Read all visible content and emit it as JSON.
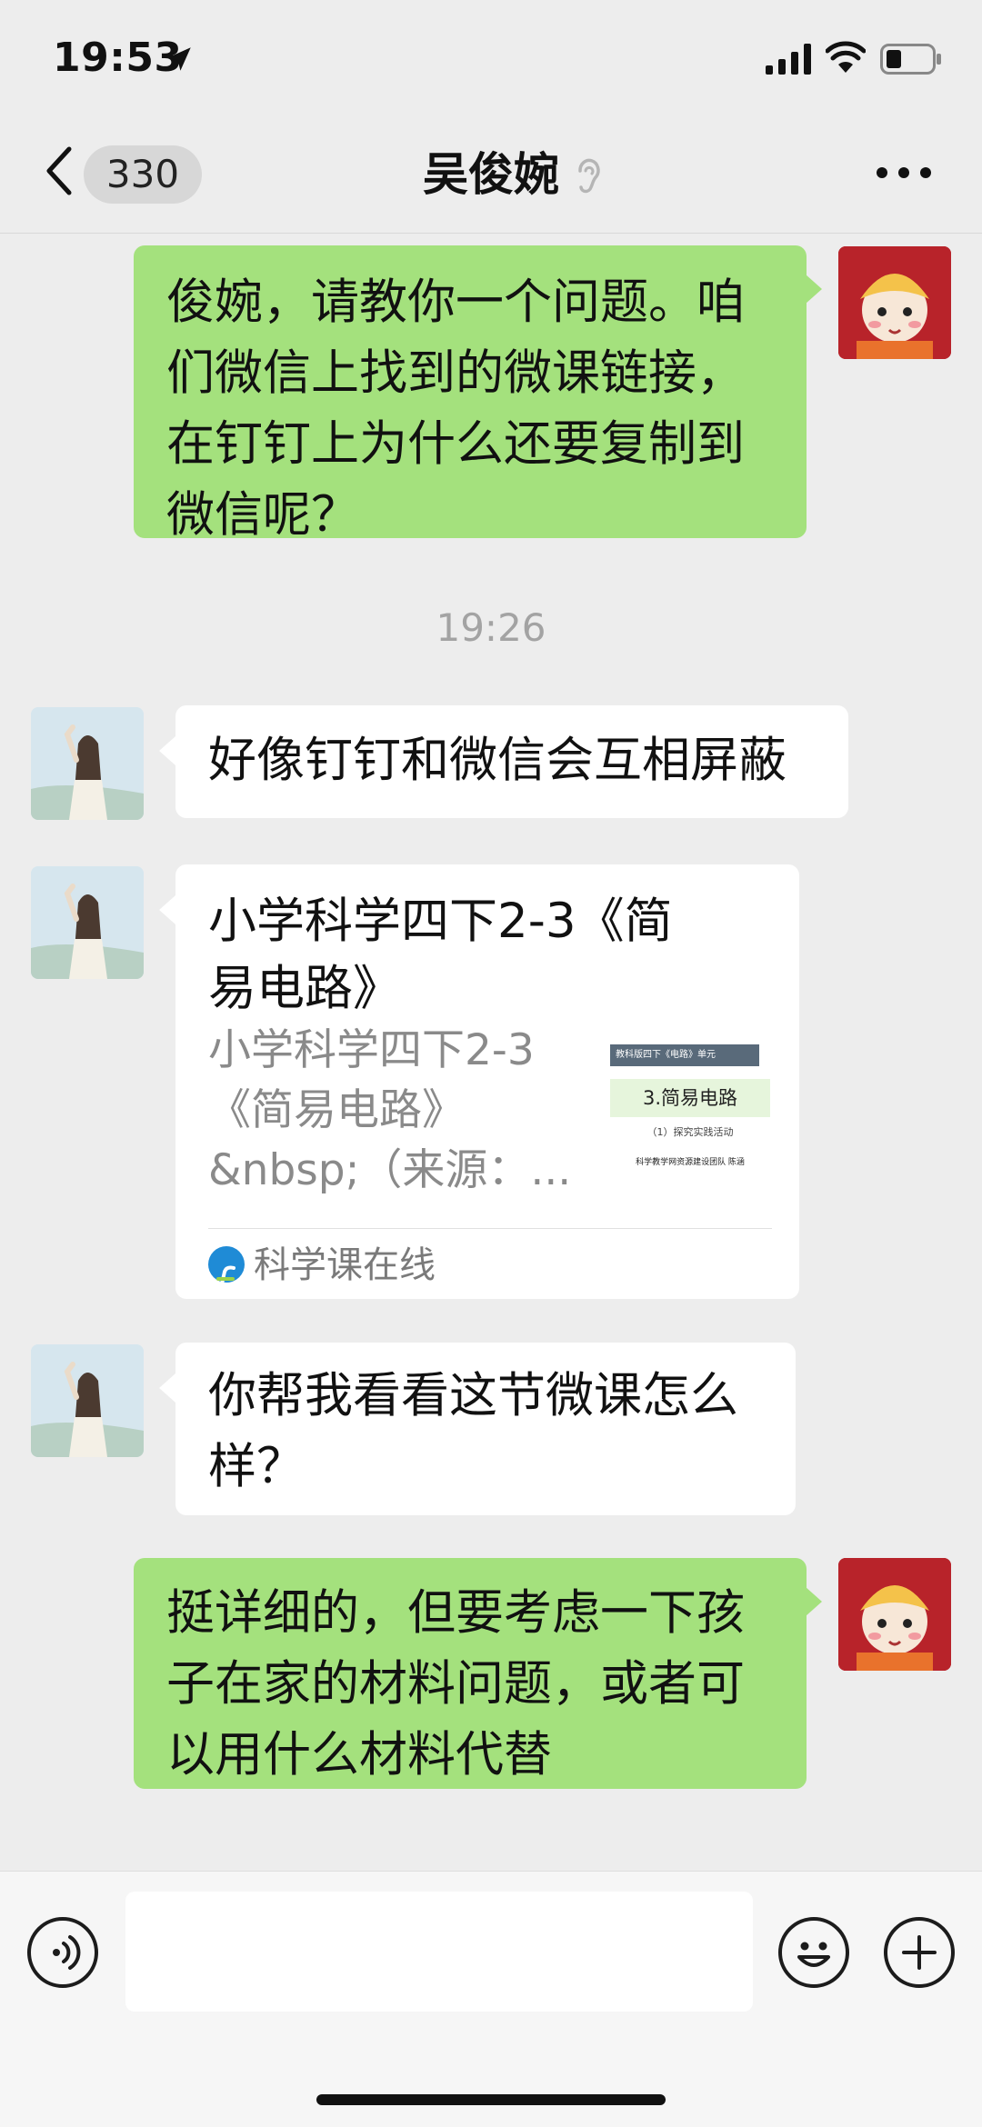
{
  "status_bar": {
    "time": "19:53"
  },
  "nav": {
    "unread_count": "330",
    "contact_name": "吴俊婉"
  },
  "messages": [
    {
      "text": "俊婉，请教你一个问题。咱们微信上找到的微课链接，在钉钉上为什么还要复制到微信呢？"
    },
    {
      "text": "19:26"
    },
    {
      "text": "好像钉钉和微信会互相屏蔽"
    },
    {
      "title": "小学科学四下2-3《简易电路》",
      "description": "小学科学四下2-3《简易电路》&nbsp;（来源：...",
      "source": "科学课在线",
      "thumbnail": {
        "header": "教科版四下《电路》单元",
        "title": "3.简易电路",
        "subtitle": "（1）探究实践活动",
        "footer": "科学教学网资源建设团队  陈涵"
      }
    },
    {
      "text": "你帮我看看这节微课怎么样？"
    },
    {
      "text": "挺详细的，但要考虑一下孩子在家的材料问题，或者可以用什么材料代替"
    }
  ],
  "colors": {
    "my_bubble": "#a4e17d",
    "their_bubble": "#ffffff",
    "background": "#ededed"
  }
}
